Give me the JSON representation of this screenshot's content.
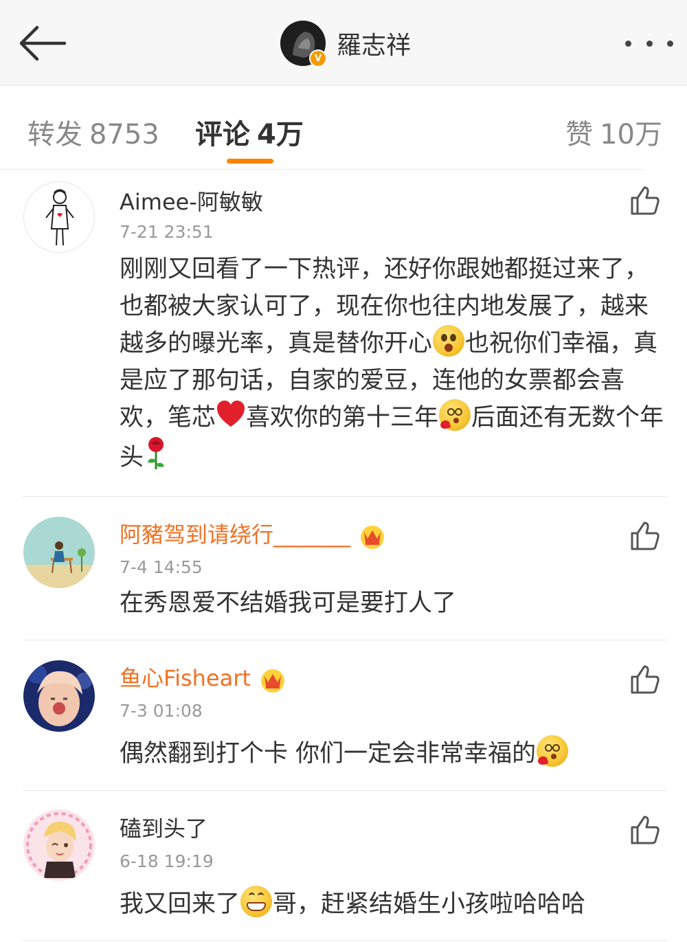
{
  "header": {
    "account_name": "羅志祥",
    "verified_badge": "V",
    "icons": {
      "back": "back-arrow-icon",
      "more": "more-dots-icon"
    }
  },
  "tabs": [
    {
      "label": "转发",
      "count": "8753",
      "active": false
    },
    {
      "label": "评论",
      "count": "4万",
      "active": true
    },
    {
      "label": "赞",
      "count": "10万",
      "active": false
    }
  ],
  "comments": [
    {
      "username": "Aimee-阿敏敏",
      "vip": false,
      "time": "7-21 23:51",
      "text_parts": [
        "刚刚又回看了一下热评，还好你跟她都挺过来了，也都被大家认可了，现在你也往内地发展了，越来越多的曝光率，真是替你开心",
        "也祝你们幸福，真是应了那句话，自家的爱豆，连他的女票都会喜欢，笔芯",
        "喜欢你的第十三年",
        "后面还有无数个年头"
      ],
      "emojis": [
        "surprised-face-emoji",
        "heart-emoji",
        "heart-eyes-face-emoji",
        "rose-emoji"
      ]
    },
    {
      "username": "阿豬驾到请绕行_______",
      "vip": true,
      "time": "7-4 14:55",
      "text": "在秀恩爱不结婚我可是要打人了"
    },
    {
      "username": "鱼心Fisheart",
      "vip": true,
      "time": "7-3 01:08",
      "text": "偶然翻到打个卡 你们一定会非常幸福的",
      "emojis": [
        "heart-eyes-face-emoji"
      ]
    },
    {
      "username": "磕到头了",
      "vip": false,
      "time": "6-18 19:19",
      "text_parts": [
        "我又回来了",
        "哥，赶紧结婚生小孩啦哈哈哈"
      ],
      "emojis": [
        "grinning-face-emoji"
      ]
    }
  ],
  "colors": {
    "accent_orange": "#ff8200",
    "vip_name": "#f37021",
    "timestamp": "#999999",
    "text": "#333333",
    "navbar_bg": "#f7f7f7"
  }
}
